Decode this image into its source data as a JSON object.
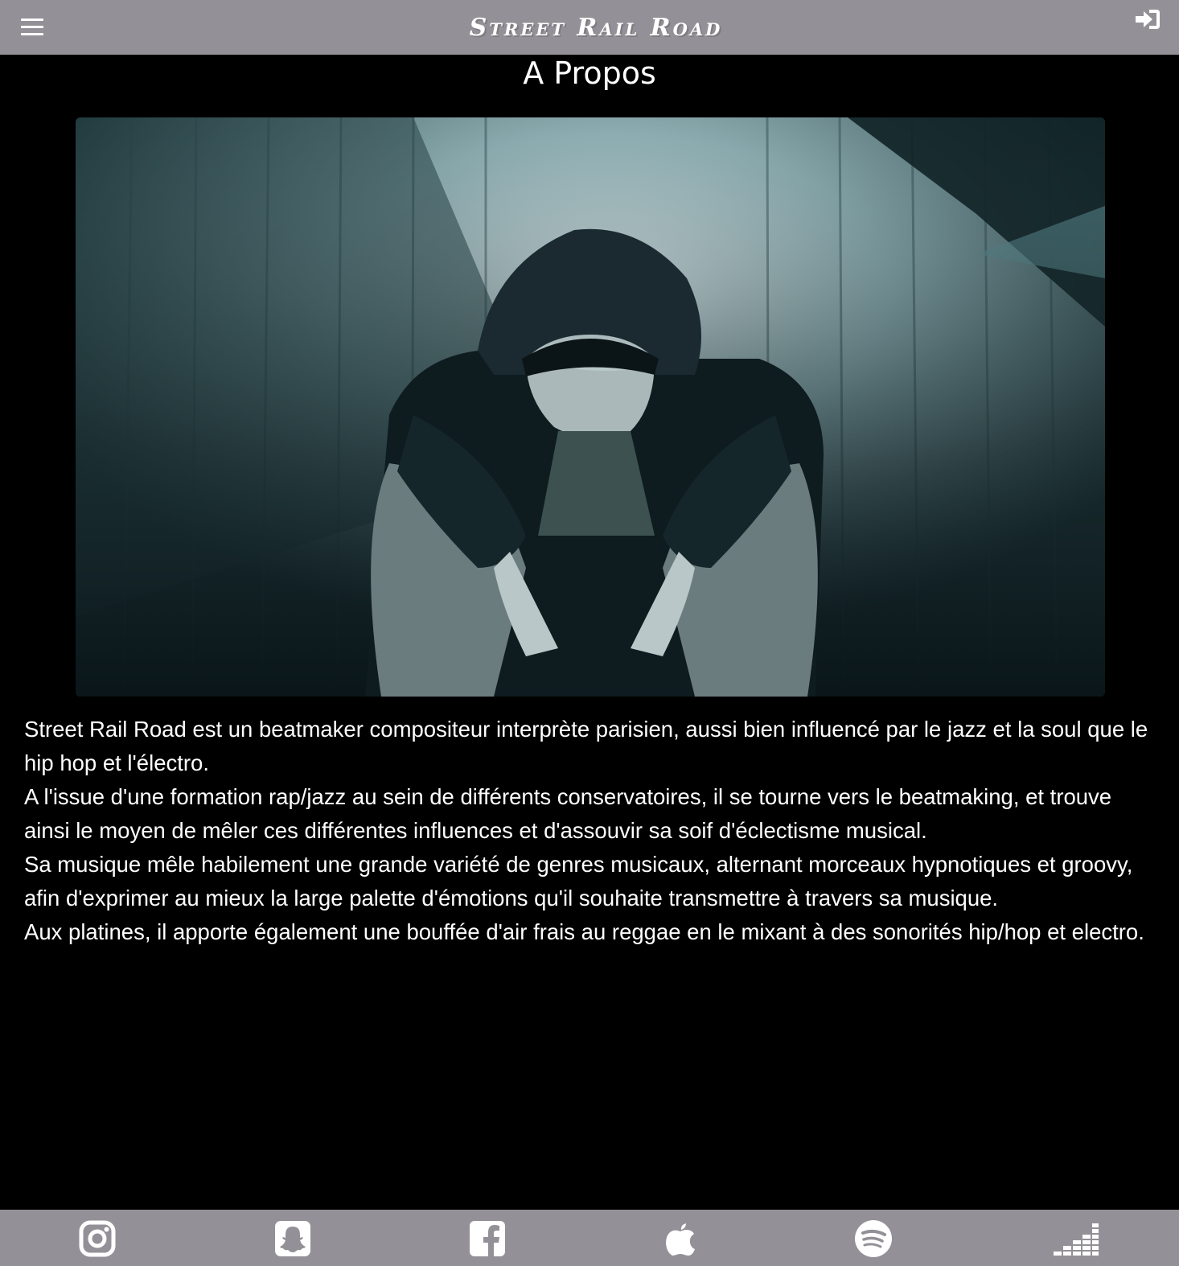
{
  "header": {
    "logo_text": "Street Rail Road",
    "menu_icon": "hamburger-menu-icon",
    "login_icon": "sign-in-icon"
  },
  "page": {
    "title": "A Propos"
  },
  "hero_image": {
    "subject": "hooded-figure-photo"
  },
  "bio": {
    "paragraphs": [
      "Street Rail Road est un beatmaker compositeur interprète parisien, aussi bien influencé par le jazz et la soul que le hip hop et l'électro.",
      "A l'issue d'une formation rap/jazz au sein de différents conservatoires, il se tourne vers le beatmaking, et trouve ainsi le moyen de mêler ces différentes influences et d'assouvir sa soif d'éclectisme musical.",
      "Sa musique mêle habilement une grande variété de genres musicaux, alternant morceaux hypnotiques et groovy, afin d'exprimer au mieux la large palette d'émotions qu'il souhaite transmettre à travers sa musique.",
      "Aux platines, il apporte également une bouffée d'air frais au reggae en le mixant à des sonorités hip/hop et electro."
    ]
  },
  "footer": {
    "social_icons": [
      "instagram-icon",
      "snapchat-icon",
      "facebook-icon",
      "apple-music-icon",
      "spotify-icon",
      "deezer-icon"
    ]
  },
  "colors": {
    "bar_background": "#939197",
    "page_background": "#000000",
    "text": "#ffffff"
  }
}
